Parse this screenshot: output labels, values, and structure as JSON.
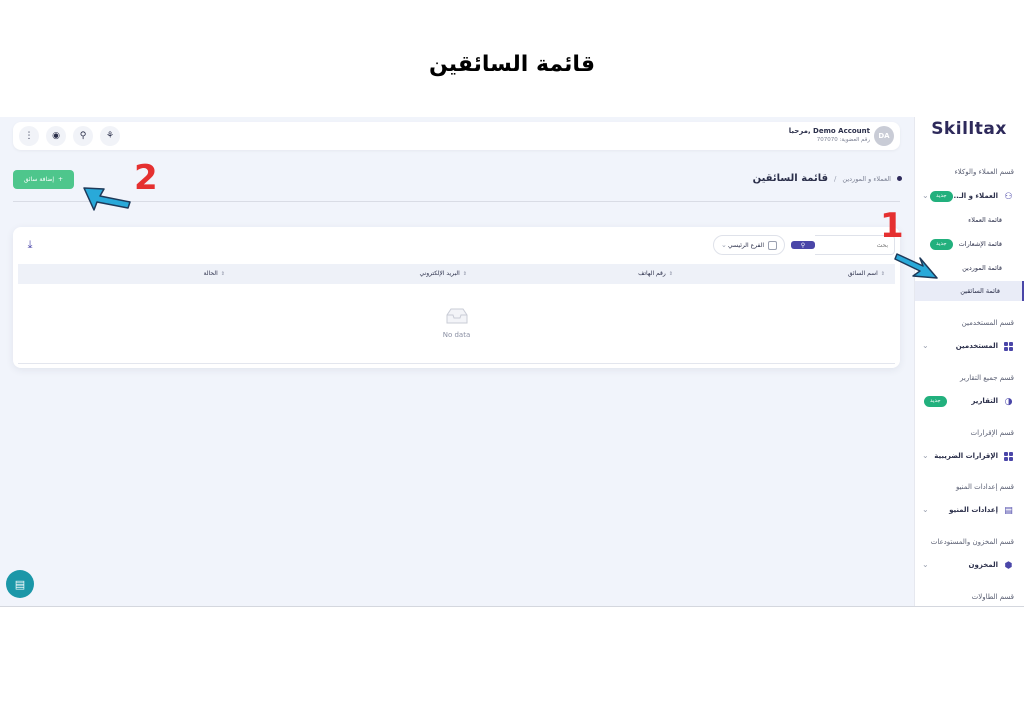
{
  "heading": "قائمة السائقين",
  "sidebar": {
    "logo": "Skilltax",
    "sections": [
      {
        "label": "قسم العملاء والوكلاء"
      },
      {
        "label": "قسم المستخدمين"
      },
      {
        "label": "قسم جميع التقارير"
      },
      {
        "label": "قسم الإقرارات"
      },
      {
        "label": "قسم إعدادات المنيو"
      },
      {
        "label": "قسم المخزون والمستودعات"
      },
      {
        "label": "قسم الطاولات"
      }
    ],
    "items": [
      {
        "label": "العملاء و الـ...",
        "badge": "جديد",
        "icon": "users-icon"
      },
      {
        "label": "المستخدمين",
        "icon": "grid-icon"
      },
      {
        "label": "التقارير",
        "badge": "جديد",
        "icon": "pie-chart-icon"
      },
      {
        "label": "الإقرارات الضريبية",
        "icon": "grid-icon"
      },
      {
        "label": "إعدادات المنيو",
        "icon": "document-icon"
      },
      {
        "label": "المخزون",
        "icon": "box-icon"
      }
    ],
    "subitems": [
      {
        "label": "قائمة العملاء"
      },
      {
        "label": "قائمة الإشعارات",
        "badge": "جديد"
      },
      {
        "label": "قائمة الموردين"
      },
      {
        "label": "قائمة السائقين"
      }
    ]
  },
  "topbar": {
    "avatar": "DA",
    "user_name": "مرحبا, Demo Account",
    "user_id": "رقم العضوية: 707070"
  },
  "header": {
    "add_button": "إضافة سائق",
    "add_icon": "+",
    "breadcrumb": "العملاء و الموردين",
    "separator": "/",
    "title": "قائمة السائقين"
  },
  "table": {
    "search_placeholder": "بحث",
    "branch": "الفرع الرئيسي",
    "columns": [
      "اسم السائق",
      "رقم الهاتف",
      "البريد الإلكتروني",
      "الحالة"
    ],
    "empty": "No data"
  },
  "annotations": [
    "1",
    "2"
  ],
  "colors": {
    "accent": "#4a46a8",
    "green": "#4ec68c",
    "badge": "#22b07d",
    "arrow": "#29a9d9",
    "annot": "#e53030"
  }
}
